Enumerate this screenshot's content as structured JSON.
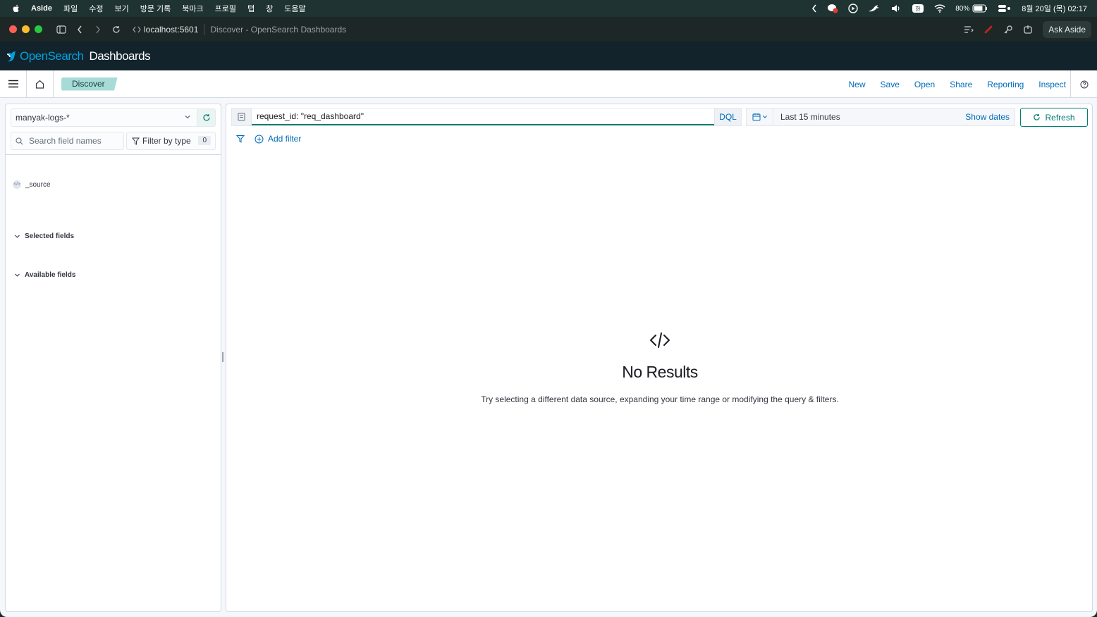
{
  "menubar": {
    "app_name": "Aside",
    "menus": [
      "파일",
      "수정",
      "보기",
      "방문 기록",
      "북마크",
      "프로필",
      "탭",
      "창",
      "도움말"
    ],
    "battery": "80%",
    "datetime": "8월 20일 (목) 02:17"
  },
  "browser": {
    "url": "localhost:5601",
    "page_title": "Discover - OpenSearch Dashboards",
    "ask_label": "Ask Aside"
  },
  "header": {
    "logo_open": "OpenSearch",
    "logo_dash": "Dashboards"
  },
  "topnav": {
    "breadcrumb": "Discover",
    "actions": [
      "New",
      "Save",
      "Open",
      "Share",
      "Reporting",
      "Inspect"
    ]
  },
  "sidebar": {
    "index_pattern": "manyak-logs-*",
    "search_placeholder": "Search field names",
    "filter_by_type": "Filter by type",
    "filter_count": "0",
    "selected_fields_label": "Selected fields",
    "selected_fields": [
      "_source"
    ],
    "available_fields_label": "Available fields"
  },
  "query": {
    "text": "request_id: \"req_dashboard\"",
    "language": "DQL",
    "time_range": "Last 15 minutes",
    "show_dates": "Show dates",
    "refresh": "Refresh",
    "add_filter": "Add filter"
  },
  "empty_state": {
    "title": "No Results",
    "body": "Try selecting a different data source, expanding your time range or modifying the query & filters."
  },
  "colors": {
    "accent": "#017d73",
    "link": "#006bb8",
    "header_bg": "#12232c",
    "breadcrumb_bg": "#a6dbd8"
  }
}
